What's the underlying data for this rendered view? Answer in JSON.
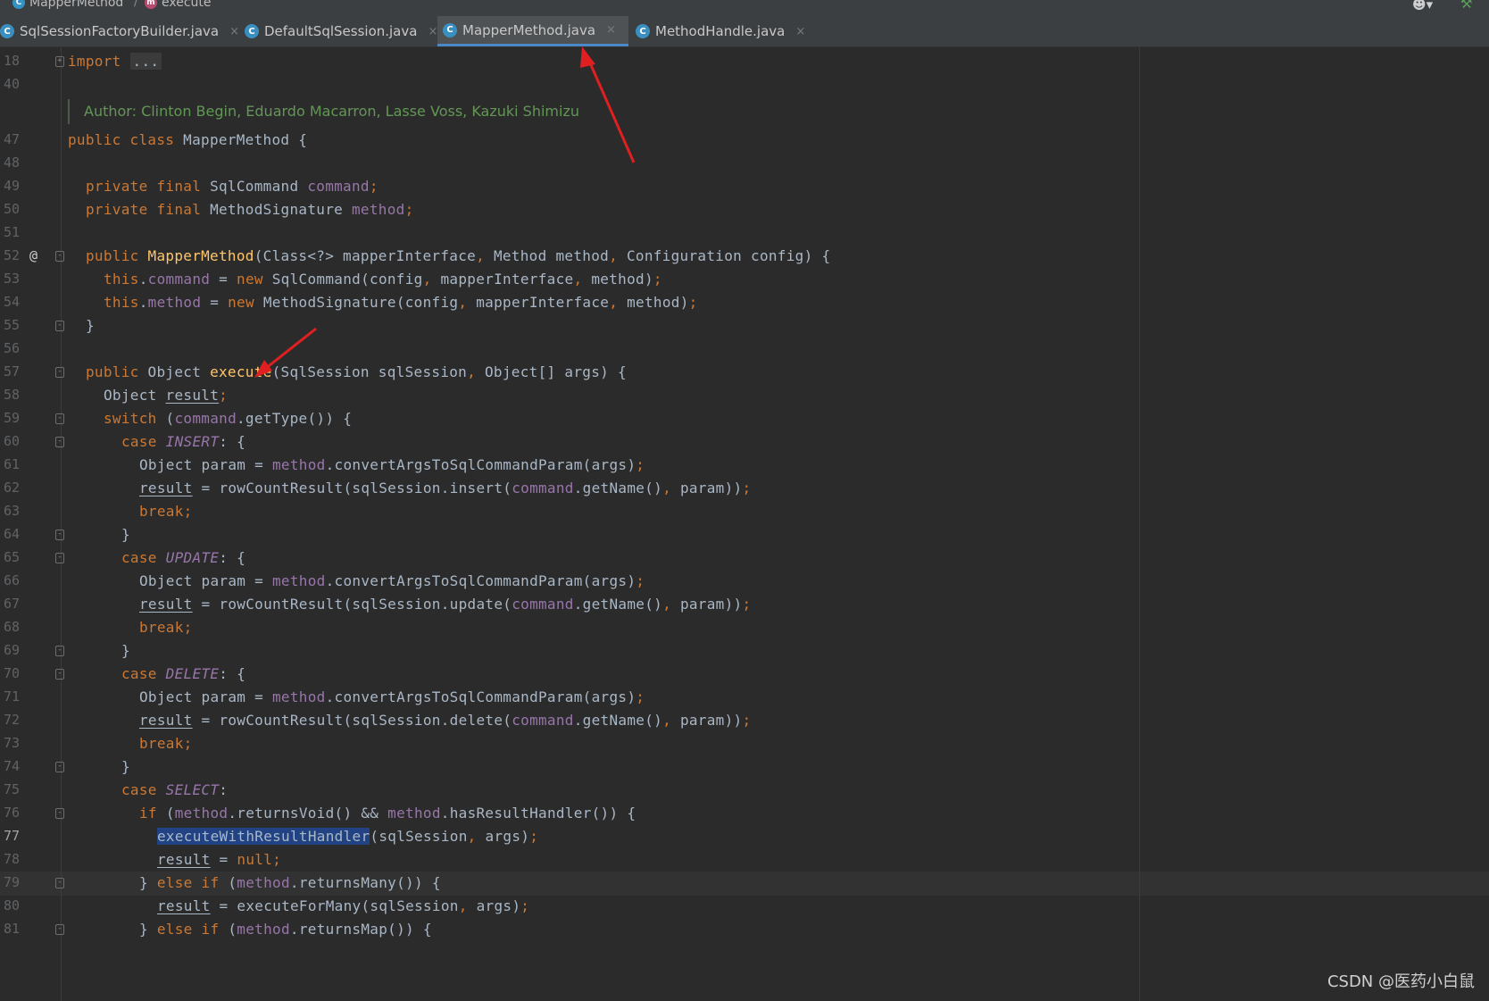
{
  "breadcrumb": {
    "class_name": "MapperMethod",
    "separator": "/",
    "method_name": "execute"
  },
  "tabs": [
    {
      "label": "SqlSessionFactoryBuilder.java",
      "active": false
    },
    {
      "label": "DefaultSqlSession.java",
      "active": false
    },
    {
      "label": "MapperMethod.java",
      "active": true
    },
    {
      "label": "MethodHandle.java",
      "active": false
    }
  ],
  "tab_close_glyph": "×",
  "editor": {
    "doc_author": "Author: Clinton Begin, Eduardo Macarron, Lasse Voss, Kazuki Shimizu",
    "current_line": "77",
    "line_numbers": [
      "18",
      "40",
      "47",
      "48",
      "49",
      "50",
      "51",
      "52",
      "53",
      "54",
      "55",
      "56",
      "57",
      "58",
      "59",
      "60",
      "61",
      "62",
      "63",
      "64",
      "65",
      "66",
      "67",
      "68",
      "69",
      "70",
      "71",
      "72",
      "73",
      "74",
      "75",
      "76",
      "77",
      "78",
      "79",
      "80",
      "81"
    ],
    "lines": {
      "l18": {
        "kw": "import",
        "dots": "..."
      },
      "l47": {
        "a": "public class ",
        "b": "MapperMethod {"
      },
      "l49": {
        "a": "private final ",
        "b": "SqlCommand ",
        "c": "command",
        "d": ";"
      },
      "l50": {
        "a": "private final ",
        "b": "MethodSignature ",
        "c": "method",
        "d": ";"
      },
      "l52": {
        "a": "public ",
        "b": "MapperMethod",
        "c": "(Class<?> mapperInterface",
        "d": ", ",
        "e": "Method method",
        "f": ", ",
        "g": "Configuration config) {"
      },
      "l53": {
        "a": "this",
        "b": ".",
        "c": "command",
        "d": " = ",
        "e": "new ",
        "f": "SqlCommand(config",
        "g": ", ",
        "h": "mapperInterface",
        "i": ", ",
        "j": "method)",
        "k": ";"
      },
      "l54": {
        "a": "this",
        "b": ".",
        "c": "method",
        "d": " = ",
        "e": "new ",
        "f": "MethodSignature(config",
        "g": ", ",
        "h": "mapperInterface",
        "i": ", ",
        "j": "method)",
        "k": ";"
      },
      "l55": {
        "a": "}"
      },
      "l57": {
        "a": "public ",
        "b": "Object ",
        "c": "execute",
        "d": "(SqlSession sqlSession",
        "e": ", ",
        "f": "Object[] args) {"
      },
      "l58": {
        "a": "Object ",
        "b": "result",
        "c": ";"
      },
      "l59": {
        "a": "switch ",
        "b": "(",
        "c": "command",
        "d": ".getType()) {"
      },
      "l60": {
        "a": "case ",
        "b": "INSERT",
        "c": ": {"
      },
      "l61": {
        "a": "Object param = ",
        "b": "method",
        "c": ".convertArgsToSqlCommandParam(args)",
        "d": ";"
      },
      "l62": {
        "a": "result",
        "b": " = rowCountResult(sqlSession.insert(",
        "c": "command",
        "d": ".getName()",
        "e": ", ",
        "f": "param))",
        "g": ";"
      },
      "l63": {
        "a": "break;"
      },
      "l64": {
        "a": "}"
      },
      "l65": {
        "a": "case ",
        "b": "UPDATE",
        "c": ": {"
      },
      "l66": {
        "a": "Object param = ",
        "b": "method",
        "c": ".convertArgsToSqlCommandParam(args)",
        "d": ";"
      },
      "l67": {
        "a": "result",
        "b": " = rowCountResult(sqlSession.update(",
        "c": "command",
        "d": ".getName()",
        "e": ", ",
        "f": "param))",
        "g": ";"
      },
      "l68": {
        "a": "break;"
      },
      "l69": {
        "a": "}"
      },
      "l70": {
        "a": "case ",
        "b": "DELETE",
        "c": ": {"
      },
      "l71": {
        "a": "Object param = ",
        "b": "method",
        "c": ".convertArgsToSqlCommandParam(args)",
        "d": ";"
      },
      "l72": {
        "a": "result",
        "b": " = rowCountResult(sqlSession.delete(",
        "c": "command",
        "d": ".getName()",
        "e": ", ",
        "f": "param))",
        "g": ";"
      },
      "l73": {
        "a": "break;"
      },
      "l74": {
        "a": "}"
      },
      "l75": {
        "a": "case ",
        "b": "SELECT",
        "c": ":"
      },
      "l76": {
        "a": "if ",
        "b": "(",
        "c": "method",
        "d": ".returnsVoid() && ",
        "e": "method",
        "f": ".hasResultHandler()) {"
      },
      "l77": {
        "a": "executeWithResultHandler",
        "b": "(sqlSession",
        "c": ", ",
        "d": "args)",
        "e": ";"
      },
      "l78": {
        "a": "result",
        "b": " = ",
        "c": "null",
        "d": ";"
      },
      "l79": {
        "a": "} ",
        "b": "else if ",
        "c": "(",
        "d": "method",
        "e": ".returnsMany()) {"
      },
      "l80": {
        "a": "result",
        "b": " = executeForMany(sqlSession",
        "c": ", ",
        "d": "args)",
        "e": ";"
      },
      "l81": {
        "a": "} ",
        "b": "else if ",
        "c": "(",
        "d": "method",
        "e": ".returnsMap()) {"
      }
    }
  },
  "gutter_override_glyph": "@",
  "watermark": "CSDN @医药小白鼠",
  "colors": {
    "editor_bg": "#2b2b2b",
    "keyword": "#cc7832",
    "field": "#9876aa",
    "method_decl": "#ffc66d",
    "doc_comment": "#629755",
    "selection": "#214283",
    "active_tab_underline": "#4a88c7",
    "annotation_arrow": "#e02020"
  }
}
